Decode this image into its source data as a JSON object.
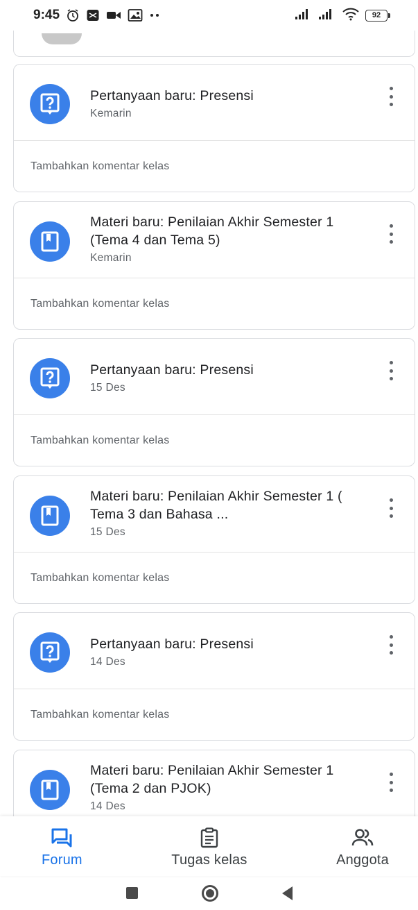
{
  "status_bar": {
    "time": "9:45",
    "battery": "92",
    "left_icons": [
      "alarm-icon",
      "sim-toolkit-icon",
      "video-call-icon",
      "photo-icon",
      "more-notifications-icon"
    ],
    "right_icons": [
      "signal-icon",
      "signal-icon",
      "wifi-icon",
      "battery-icon"
    ]
  },
  "colors": {
    "accent": "#1a73e8",
    "icon_circle": "#3a80e9",
    "text_secondary": "#5f6368"
  },
  "posts": [
    {
      "type": "question",
      "icon": "question-icon",
      "title": "Pertanyaan baru: Presensi",
      "date": "Kemarin",
      "comment_placeholder": "Tambahkan komentar kelas"
    },
    {
      "type": "material",
      "icon": "book-icon",
      "title": "Materi baru: Penilaian Akhir Semester 1 (Tema 4 dan Tema 5)",
      "date": "Kemarin",
      "comment_placeholder": "Tambahkan komentar kelas"
    },
    {
      "type": "question",
      "icon": "question-icon",
      "title": "Pertanyaan baru: Presensi",
      "date": "15 Des",
      "comment_placeholder": "Tambahkan komentar kelas"
    },
    {
      "type": "material",
      "icon": "book-icon",
      "title": "Materi baru: Penilaian Akhir Semester 1 ( Tema 3 dan Bahasa ...",
      "date": "15 Des",
      "comment_placeholder": "Tambahkan komentar kelas"
    },
    {
      "type": "question",
      "icon": "question-icon",
      "title": "Pertanyaan baru: Presensi",
      "date": "14 Des",
      "comment_placeholder": "Tambahkan komentar kelas"
    },
    {
      "type": "material",
      "icon": "book-icon",
      "title": "Materi baru: Penilaian Akhir Semester 1 (Tema 2 dan PJOK)",
      "date": "14 Des",
      "comment_placeholder": ""
    }
  ],
  "bottom_nav": [
    {
      "label": "Forum",
      "icon": "forum-icon",
      "active": true
    },
    {
      "label": "Tugas kelas",
      "icon": "assignment-icon",
      "active": false
    },
    {
      "label": "Anggota",
      "icon": "people-icon",
      "active": false
    }
  ],
  "system_nav": [
    "recents-icon",
    "home-icon",
    "back-icon"
  ]
}
